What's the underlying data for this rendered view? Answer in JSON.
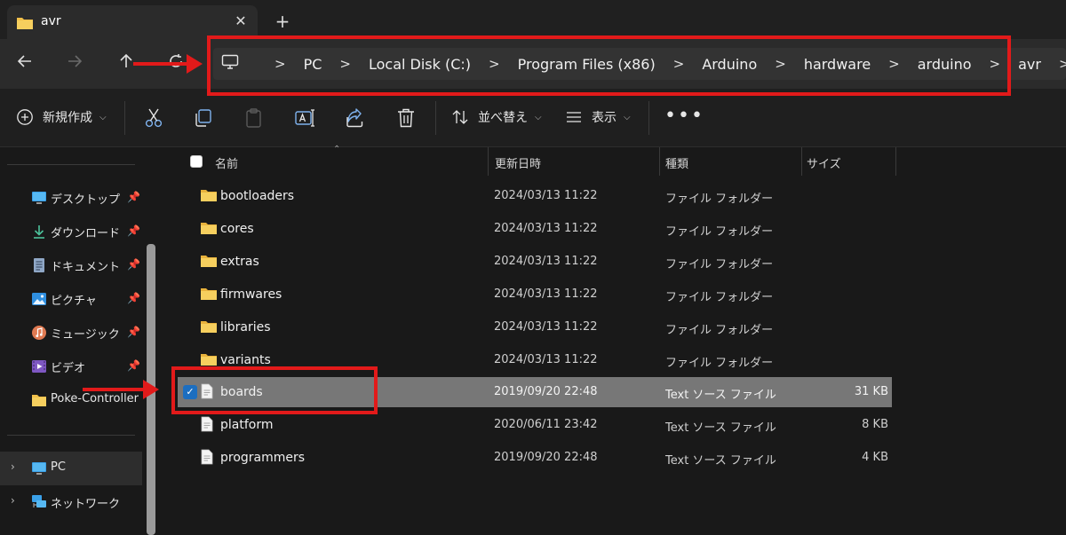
{
  "tab": {
    "title": "avr",
    "close": "✕",
    "new_tab": "+"
  },
  "nav": {
    "back": "back-arrow-icon",
    "forward": "forward-arrow-icon",
    "up": "up-arrow-icon",
    "refresh": "refresh-icon"
  },
  "breadcrumb": {
    "separator": ">",
    "items": [
      "PC",
      "Local Disk (C:)",
      "Program Files (x86)",
      "Arduino",
      "hardware",
      "arduino",
      "avr"
    ]
  },
  "toolbar": {
    "new_label": "新規作成",
    "sort_label": "並べ替え",
    "view_label": "表示",
    "more_label": "•••"
  },
  "sidebar": {
    "quick_access": [
      {
        "label": "デスクトップ",
        "icon": "desktop-icon",
        "pinned": true
      },
      {
        "label": "ダウンロード",
        "icon": "download-icon",
        "pinned": true
      },
      {
        "label": "ドキュメント",
        "icon": "documents-icon",
        "pinned": true
      },
      {
        "label": "ピクチャ",
        "icon": "pictures-icon",
        "pinned": true
      },
      {
        "label": "ミュージック",
        "icon": "music-icon",
        "pinned": true
      },
      {
        "label": "ビデオ",
        "icon": "videos-icon",
        "pinned": true
      },
      {
        "label": "Poke-Controller",
        "icon": "folder-icon",
        "pinned": false
      }
    ],
    "locations": [
      {
        "label": "PC",
        "icon": "pc-icon",
        "active": true
      },
      {
        "label": "ネットワーク",
        "icon": "network-icon",
        "active": false
      }
    ]
  },
  "columns": {
    "name": "名前",
    "modified": "更新日時",
    "type": "種類",
    "size": "サイズ"
  },
  "files": [
    {
      "name": "bootloaders",
      "modified": "2024/03/13 11:22",
      "type": "ファイル フォルダー",
      "size": "",
      "kind": "folder"
    },
    {
      "name": "cores",
      "modified": "2024/03/13 11:22",
      "type": "ファイル フォルダー",
      "size": "",
      "kind": "folder"
    },
    {
      "name": "extras",
      "modified": "2024/03/13 11:22",
      "type": "ファイル フォルダー",
      "size": "",
      "kind": "folder"
    },
    {
      "name": "firmwares",
      "modified": "2024/03/13 11:22",
      "type": "ファイル フォルダー",
      "size": "",
      "kind": "folder"
    },
    {
      "name": "libraries",
      "modified": "2024/03/13 11:22",
      "type": "ファイル フォルダー",
      "size": "",
      "kind": "folder"
    },
    {
      "name": "variants",
      "modified": "2024/03/13 11:22",
      "type": "ファイル フォルダー",
      "size": "",
      "kind": "folder"
    },
    {
      "name": "boards",
      "modified": "2019/09/20 22:48",
      "type": "Text ソース ファイル",
      "size": "31 KB",
      "kind": "file",
      "selected": true
    },
    {
      "name": "platform",
      "modified": "2020/06/11 23:42",
      "type": "Text ソース ファイル",
      "size": "8 KB",
      "kind": "file"
    },
    {
      "name": "programmers",
      "modified": "2019/09/20 22:48",
      "type": "Text ソース ファイル",
      "size": "4 KB",
      "kind": "file"
    }
  ],
  "colors": {
    "annotation": "#e21a1a",
    "folder": "#f2c04a",
    "selection": "#777777",
    "checkbox": "#1c6ec0"
  }
}
